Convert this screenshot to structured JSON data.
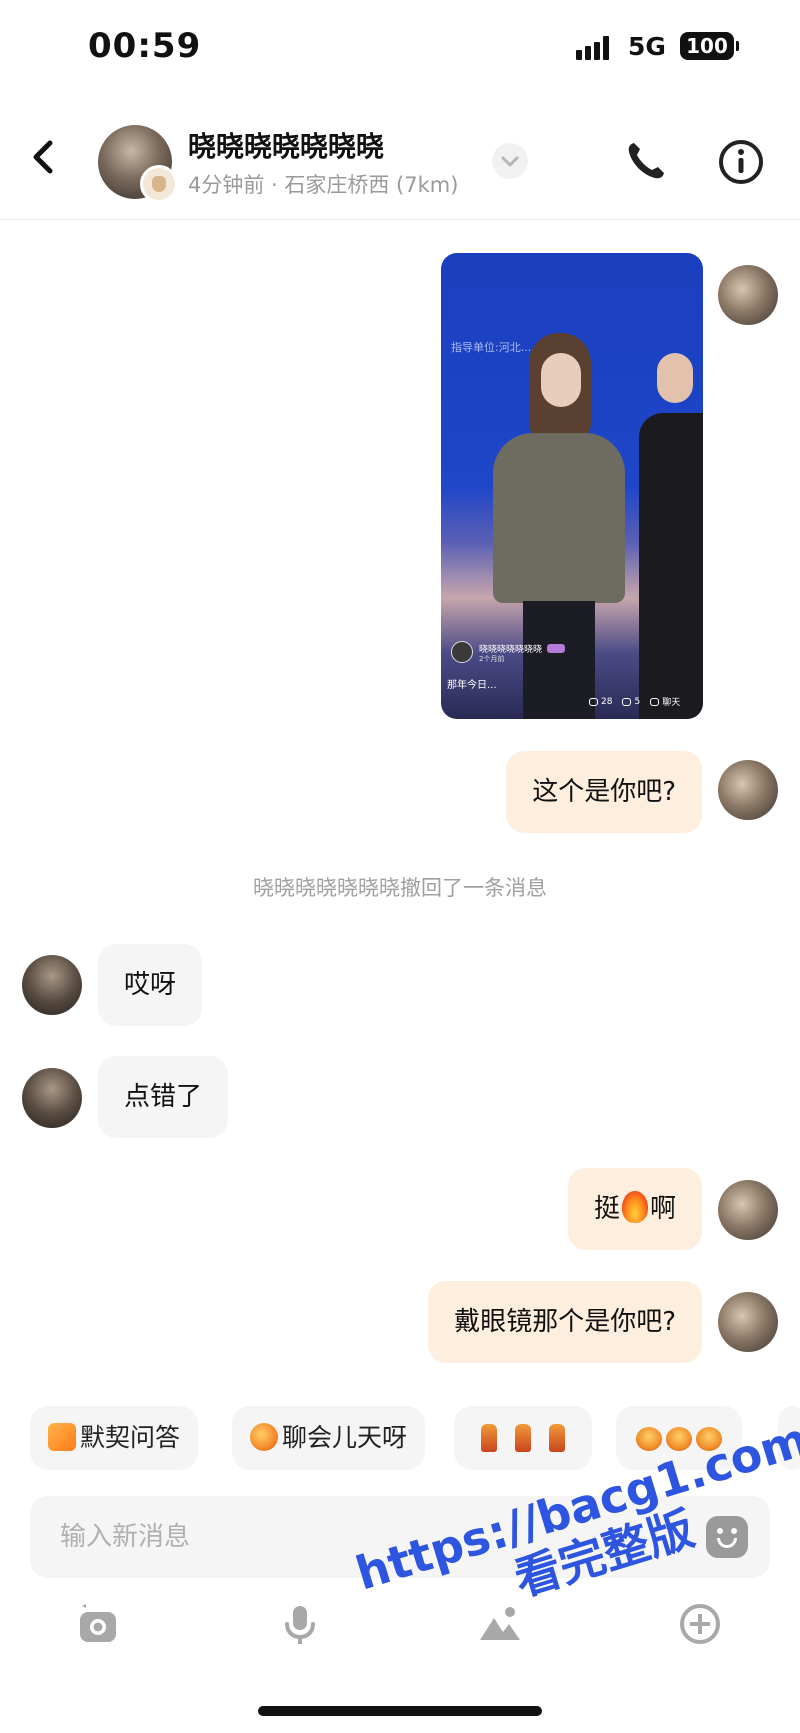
{
  "status_bar": {
    "time": "00:59",
    "network": "5G",
    "battery": "100"
  },
  "header": {
    "name": "晓晓晓晓晓晓晓",
    "subtitle": "4分钟前 · 石家庄桥西 (7km)"
  },
  "media_card": {
    "screen_text": "指导单位:河北...",
    "username": "晓晓晓晓晓晓晓",
    "time": "2个月前",
    "caption": "那年今日...",
    "likes": "28",
    "shares": "5",
    "chat_label": "聊天"
  },
  "messages": [
    {
      "from": "me",
      "text": "这个是你吧?"
    },
    {
      "from": "system",
      "text": "晓晓晓晓晓晓晓撤回了一条消息"
    },
    {
      "from": "other",
      "text": "哎呀"
    },
    {
      "from": "other",
      "text": "点错了"
    },
    {
      "from": "me",
      "text_before": "挺",
      "emoji": "fire",
      "text_after": "啊"
    },
    {
      "from": "me",
      "text": "戴眼镜那个是你吧?"
    }
  ],
  "quick_replies": [
    {
      "icon": "pencil-icon",
      "label": "默契问答"
    },
    {
      "icon": "chat-bubble-icon",
      "label": "聊会儿天呀"
    },
    {
      "icon": "bottle-emoji-icon",
      "label": ""
    },
    {
      "icon": "cheer-emoji-icon",
      "label": ""
    }
  ],
  "input": {
    "placeholder": "输入新消息"
  },
  "toolbar": [
    "camera-icon",
    "microphone-icon",
    "image-icon",
    "plus-icon"
  ],
  "watermark": {
    "line1": "https://bacg1.com",
    "line2": "看完整版"
  },
  "colors": {
    "my_bubble": "#fdeede",
    "other_bubble": "#f5f5f5",
    "watermark": "#2d55e0"
  }
}
